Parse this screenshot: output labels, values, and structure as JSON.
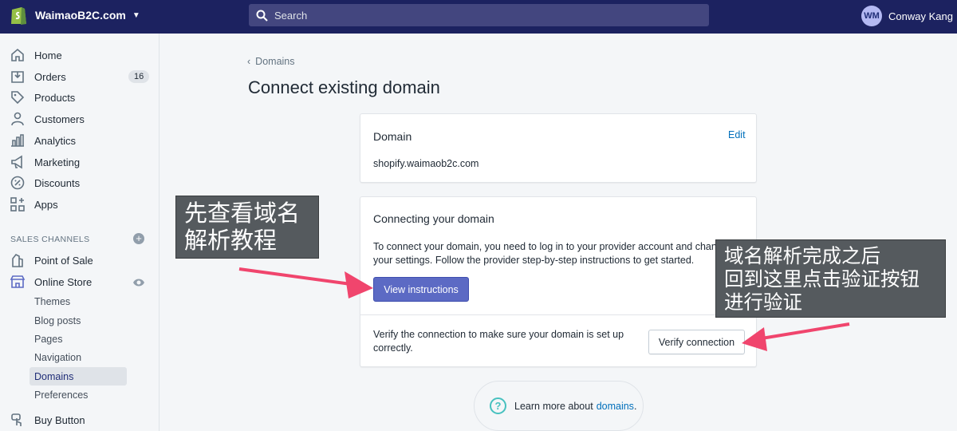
{
  "topbar": {
    "store_name": "WaimaoB2C.com",
    "search_placeholder": "Search",
    "user_initials": "WM",
    "user_name": "Conway Kang"
  },
  "sidebar": {
    "items": [
      {
        "label": "Home",
        "icon": "home-icon"
      },
      {
        "label": "Orders",
        "icon": "orders-icon",
        "badge": "16"
      },
      {
        "label": "Products",
        "icon": "tag-icon"
      },
      {
        "label": "Customers",
        "icon": "person-icon"
      },
      {
        "label": "Analytics",
        "icon": "analytics-icon"
      },
      {
        "label": "Marketing",
        "icon": "megaphone-icon"
      },
      {
        "label": "Discounts",
        "icon": "discount-icon"
      },
      {
        "label": "Apps",
        "icon": "apps-icon"
      }
    ],
    "sales_channels_heading": "SALES CHANNELS",
    "channels": [
      {
        "label": "Point of Sale",
        "icon": "pos-icon"
      },
      {
        "label": "Online Store",
        "icon": "store-icon"
      }
    ],
    "online_store_subitems": [
      "Themes",
      "Blog posts",
      "Pages",
      "Navigation",
      "Domains",
      "Preferences"
    ],
    "active_subitem": "Domains",
    "buy_button": {
      "label": "Buy Button",
      "icon": "buy-button-icon"
    }
  },
  "main": {
    "breadcrumb": "Domains",
    "title": "Connect existing domain",
    "domain_card": {
      "title": "Domain",
      "edit_label": "Edit",
      "domain": "shopify.waimaob2c.com"
    },
    "connect_card": {
      "title": "Connecting your domain",
      "description": "To connect your domain, you need to log in to your provider account and change your settings. Follow the provider step-by-step instructions to get started.",
      "view_button": "View instructions",
      "verify_text": "Verify the connection to make sure your domain is set up correctly.",
      "verify_button": "Verify connection"
    },
    "learn_more": {
      "prefix": "Learn more about",
      "link": "domains",
      "suffix": "."
    }
  },
  "annotations": {
    "note1": [
      "先查看域名",
      "解析教程"
    ],
    "note2": [
      "域名解析完成之后",
      "回到这里点击验证按钮",
      "进行验证"
    ],
    "arrow_color": "#f0456d"
  },
  "colors": {
    "topbar": "#1c2260",
    "primary_button": "#5c6ac4",
    "link": "#006fbb"
  }
}
